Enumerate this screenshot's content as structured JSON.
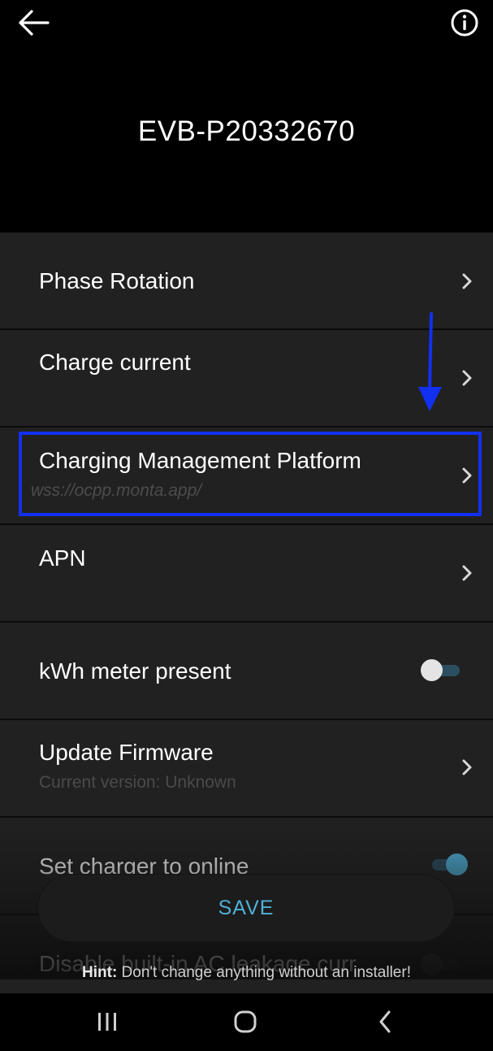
{
  "header": {
    "back_icon": "arrow-left-icon",
    "info_icon": "info-circle-icon",
    "device_id": "EVB-P20332670"
  },
  "settings": {
    "phase_rotation": {
      "label": "Phase Rotation"
    },
    "charge_current": {
      "label": "Charge current"
    },
    "charging_management_platform": {
      "label": "Charging Management Platform",
      "value": "wss://ocpp.monta.app/"
    },
    "apn": {
      "label": "APN"
    },
    "kwh_meter": {
      "label": "kWh meter present",
      "enabled": false
    },
    "update_firmware": {
      "label": "Update Firmware",
      "subtitle": "Current version: Unknown"
    },
    "set_online": {
      "label": "Set charger to online",
      "enabled": true
    },
    "ac_leakage": {
      "label": "Disable built-in AC leakage curr",
      "enabled": false
    }
  },
  "footer": {
    "save_label": "SAVE",
    "hint_prefix": "Hint:",
    "hint_text": " Don't change anything without an installer!"
  },
  "colors": {
    "background": "#000000",
    "list_background": "#212121",
    "accent": "#4fb0d8",
    "annotation": "#1230f0"
  }
}
